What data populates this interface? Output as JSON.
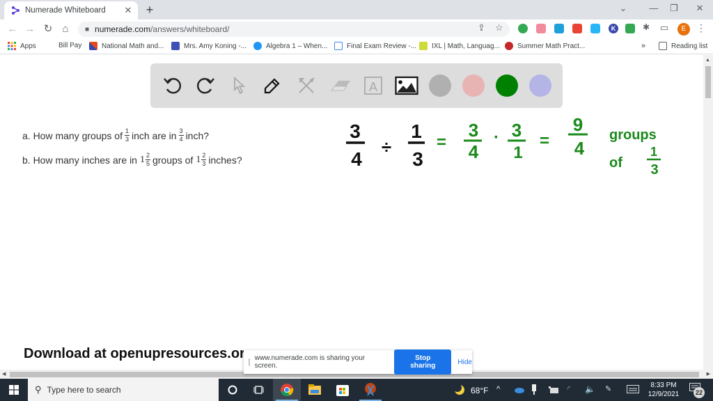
{
  "browser": {
    "tab": {
      "title": "Numerade Whiteboard",
      "close_icon": "close-icon",
      "favicon": "numerade-logo-icon"
    },
    "new_tab_label": "+",
    "window_controls": {
      "tab_search": "⌄",
      "minimize": "—",
      "restore": "❐",
      "close": "✕"
    },
    "nav": {
      "back": "←",
      "forward": "→",
      "reload": "↻",
      "home": "⌂"
    },
    "address": {
      "lock": "🔒",
      "domain": "numerade.com",
      "path": "/answers/whiteboard/"
    },
    "omnibox_icons": {
      "share": "⇪",
      "bookmark_star": "☆"
    },
    "extensions": [
      {
        "name": "green-plus-extension",
        "color": "#34a853"
      },
      {
        "name": "pink-play-extension",
        "color": "#f28b9c"
      },
      {
        "name": "cloud-extension",
        "color": "#1ea0d9"
      },
      {
        "name": "red-bookmark-extension",
        "color": "#ea4335"
      },
      {
        "name": "blue-diamond-extension",
        "color": "#29b6f6"
      },
      {
        "name": "k-extension",
        "color": "#3949ab",
        "label": "K"
      },
      {
        "name": "green-face-extension",
        "color": "#34a853"
      }
    ],
    "puzzle_icon": "✱",
    "cast_icon": "▭",
    "profile_initial": "E",
    "menu": "⋮",
    "bookmarks": [
      {
        "label": "Apps",
        "icon_color": "#ea4335"
      },
      {
        "label": "Bill Pay",
        "icon_color": ""
      },
      {
        "label": "National Math and...",
        "icon_color": "#e64a19"
      },
      {
        "label": "Mrs. Amy Koning -...",
        "icon_color": "#3f51b5"
      },
      {
        "label": "Algebra 1 – When...",
        "icon_color": "#2196f3"
      },
      {
        "label": "Final Exam Review -...",
        "icon_color": "#4285f4"
      },
      {
        "label": "IXL | Math, Languag...",
        "icon_color": "#cddc39"
      },
      {
        "label": "Summer Math Pract...",
        "icon_color": "#c62828"
      }
    ],
    "bookmarks_overflow": "»",
    "reading_list": "Reading list"
  },
  "whiteboard": {
    "tools": [
      {
        "name": "undo-tool",
        "state": "enabled"
      },
      {
        "name": "redo-tool",
        "state": "enabled"
      },
      {
        "name": "select-tool",
        "state": "disabled"
      },
      {
        "name": "pen-tool",
        "state": "active"
      },
      {
        "name": "tools-tool",
        "state": "disabled"
      },
      {
        "name": "eraser-tool",
        "state": "disabled"
      },
      {
        "name": "text-tool",
        "state": "disabled"
      },
      {
        "name": "image-tool",
        "state": "enabled"
      }
    ],
    "colors": [
      "#b0b0b0",
      "#e8b3b3",
      "#008000",
      "#b4b4e6"
    ],
    "text_tool_label": "A"
  },
  "problem": {
    "a": {
      "prefix": "a. How many groups of",
      "f1_num": "1",
      "f1_den": "3",
      "mid": "inch are in",
      "f2_num": "3",
      "f2_den": "4",
      "suffix": "inch?"
    },
    "b": {
      "prefix": "b. How many inches are in",
      "m1_whole": "1",
      "m1_num": "2",
      "m1_den": "5",
      "mid": "groups of",
      "m2_whole": "1",
      "m2_num": "2",
      "m2_den": "3",
      "suffix": "inches?"
    }
  },
  "handwriting": {
    "black_color": "#111111",
    "green_color": "#1a8a1a",
    "lhs_num": "3",
    "lhs_den": "4",
    "div_sign": "÷",
    "rhs_num": "1",
    "rhs_den": "3",
    "eq1": "=",
    "p1_num": "3",
    "p1_den": "4",
    "dot": "·",
    "p2_num": "3",
    "p2_den": "1",
    "eq2": "=",
    "res_num": "9",
    "res_den": "4",
    "groups_word": "groups",
    "of_word": "of",
    "of_num": "1",
    "of_den": "3"
  },
  "footer_text": "Download at openupresources.or",
  "sharing_bar": {
    "message": "www.numerade.com is sharing your screen.",
    "stop_label": "Stop sharing",
    "hide_label": "Hide"
  },
  "taskbar": {
    "search_placeholder": "Type here to search",
    "weather_temp": "68°F",
    "time": "8:33 PM",
    "date": "12/9/2021",
    "notification_count": "22"
  }
}
